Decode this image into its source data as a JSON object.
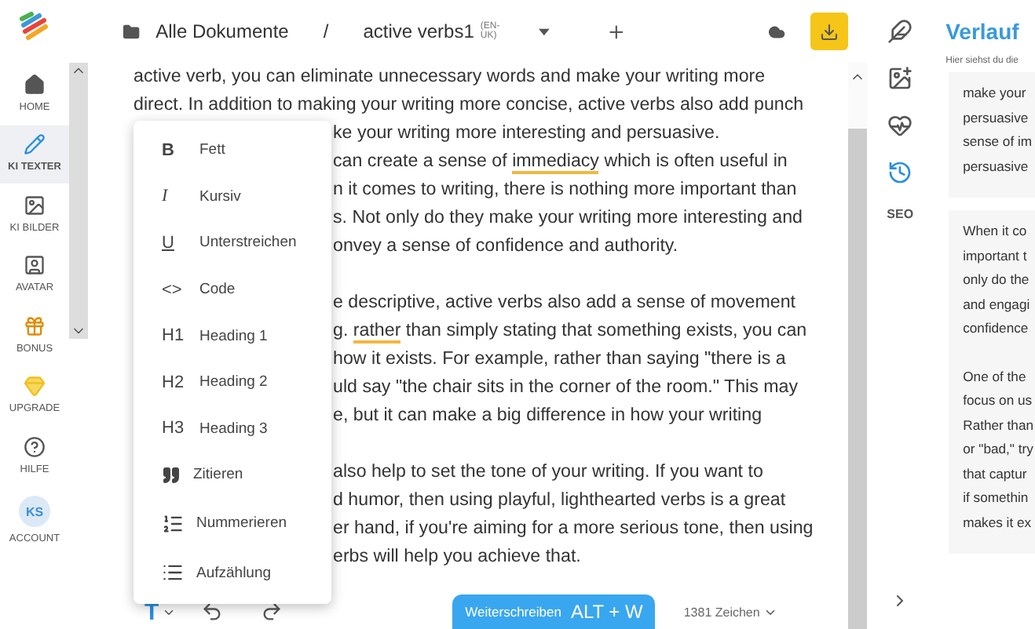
{
  "sidebar": {
    "items": [
      {
        "label": "HOME",
        "kind": "home",
        "selected": false
      },
      {
        "label": "KI TEXTER",
        "kind": "pen",
        "selected": true
      },
      {
        "label": "KI BILDER",
        "kind": "image",
        "selected": false
      },
      {
        "label": "AVATAR",
        "kind": "avatar",
        "selected": false
      },
      {
        "label": "BONUS",
        "kind": "gift",
        "selected": false
      },
      {
        "label": "UPGRADE",
        "kind": "gem",
        "selected": false
      },
      {
        "label": "HILFE",
        "kind": "help",
        "selected": false
      },
      {
        "label": "ACCOUNT",
        "kind": "account",
        "initials": "KS",
        "selected": false
      }
    ]
  },
  "breadcrumb": {
    "root": "Alle Dokumente",
    "separator": "/",
    "document": "active verbs1",
    "language": "(EN-UK)"
  },
  "editor": {
    "lines_above_menu": [
      [
        {
          "text": "active verb, you can eliminate unnecessary words and make your writing more",
          "marked": false
        }
      ],
      [
        {
          "text": "direct. In addition to making your writing more concise, active verbs also add punch",
          "marked": false
        }
      ]
    ],
    "paragraphs_beside_menu": [
      [
        [
          {
            "text": "ke your writing more interesting and persuasive.",
            "marked": false
          }
        ],
        [
          {
            "text": "can create a sense of ",
            "marked": false
          },
          {
            "text": "immediacy",
            "marked": true
          },
          {
            "text": " which is often useful in",
            "marked": false
          }
        ],
        [
          {
            "text": "n it comes to writing, there is nothing more important than",
            "marked": false
          }
        ],
        [
          {
            "text": "s. Not only do they make your writing more interesting and",
            "marked": false
          }
        ],
        [
          {
            "text": "onvey a sense of confidence and authority.",
            "marked": false
          }
        ]
      ],
      [
        [
          {
            "text": "e descriptive, active verbs also add a sense of movement",
            "marked": false
          }
        ],
        [
          {
            "text": "g. ",
            "marked": false
          },
          {
            "text": "rather",
            "marked": true
          },
          {
            "text": " than simply stating that something exists, you can",
            "marked": false
          }
        ],
        [
          {
            "text": "how it exists. For example, rather than saying \"there is a",
            "marked": false
          }
        ],
        [
          {
            "text": "uld say \"the chair sits in the corner of the room.\" This may",
            "marked": false
          }
        ],
        [
          {
            "text": "e, but it can make a big difference in how your writing",
            "marked": false
          }
        ]
      ],
      [
        [
          {
            "text": "also help to set the tone of your writing. If you want to",
            "marked": false
          }
        ],
        [
          {
            "text": "d humor, then using playful, lighthearted verbs is a great",
            "marked": false
          }
        ],
        [
          {
            "text": "er hand, if you're aiming for a more serious tone, then using",
            "marked": false
          }
        ],
        [
          {
            "text": "erbs will help you achieve that.",
            "marked": false
          }
        ]
      ]
    ]
  },
  "format_menu": {
    "items": [
      {
        "kind": "bold",
        "glyph": "B",
        "label": "Fett"
      },
      {
        "kind": "italic",
        "glyph": "I",
        "label": "Kursiv"
      },
      {
        "kind": "underline",
        "glyph": "U",
        "label": "Unterstreichen"
      },
      {
        "kind": "glyph",
        "glyph": "<>",
        "label": "Code"
      },
      {
        "kind": "glyph",
        "glyph": "H1",
        "label": "Heading 1"
      },
      {
        "kind": "glyph",
        "glyph": "H2",
        "label": "Heading 2"
      },
      {
        "kind": "glyph",
        "glyph": "H3",
        "label": "Heading 3"
      },
      {
        "kind": "quote",
        "label": "Zitieren"
      },
      {
        "kind": "numbered",
        "label": "Nummerieren"
      },
      {
        "kind": "bulleted",
        "label": "Aufzählung"
      }
    ]
  },
  "bottom_bar": {
    "format_glyph": "T",
    "continue_button": "Weiterschreiben",
    "shortcut": "ALT + W",
    "char_count": "1381 Zeichen"
  },
  "tools": {
    "items": [
      {
        "kind": "feather",
        "selected": false
      },
      {
        "kind": "image-search",
        "selected": false
      },
      {
        "kind": "heart",
        "selected": false
      },
      {
        "kind": "history",
        "selected": true
      },
      {
        "kind": "text",
        "label": "SEO",
        "selected": false
      }
    ]
  },
  "history_panel": {
    "title": "Verlauf",
    "subtitle": "Hier siehst du die",
    "cards": [
      {
        "paragraphs": [
          [
            "make your",
            "persuasive",
            "sense of im",
            "persuasive"
          ]
        ]
      },
      {
        "paragraphs": [
          [
            "When it co",
            "important t",
            "only do the",
            "and engagi",
            "confidence"
          ],
          [
            "One of the",
            "focus on us",
            "Rather than",
            "or \"bad,\" try",
            "that captur",
            "if somethin",
            "makes it ex"
          ]
        ]
      }
    ]
  }
}
